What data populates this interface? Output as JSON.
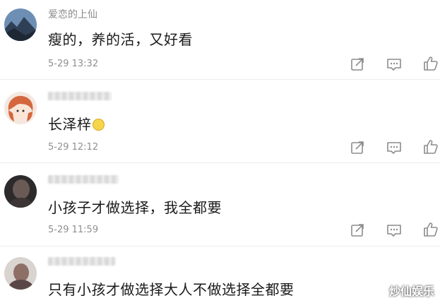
{
  "comments": [
    {
      "author": "爱恋的上仙",
      "text": "瘦的，养的活，又好看",
      "time": "5-29 13:32"
    },
    {
      "author": "",
      "text": "长泽梓",
      "time": "5-29 12:12"
    },
    {
      "author": "",
      "text": "小孩子才做选择，我全都要",
      "time": "5-29 11:59"
    },
    {
      "author": "",
      "text": "只有小孩才做选择大人不做选择全都要",
      "time": ""
    }
  ],
  "icons": {
    "share": "share-icon",
    "reply": "comment-icon",
    "like": "thumbs-up-icon",
    "emoji": "smile-emoji-icon"
  },
  "watermark": "炒仙娱乐"
}
